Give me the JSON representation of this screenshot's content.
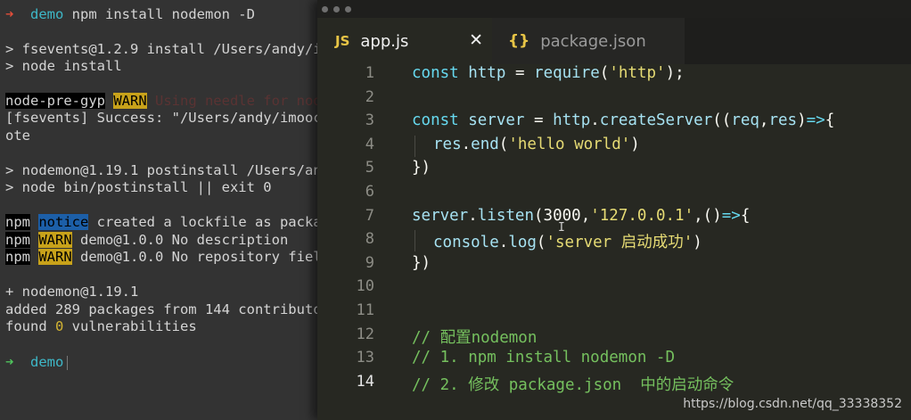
{
  "terminal": {
    "lines": [
      {
        "prompt_arrow": "➜",
        "dir": "demo",
        "cmd": " npm install nodemon -D"
      },
      {
        "text": "> fsevents@1.2.9 install /Users/andy/i"
      },
      {
        "text": "> node install"
      },
      {
        "tag": "node-pre-gyp",
        "warn": "WARN",
        "rest": " Using needle for nod"
      },
      {
        "text": "[fsevents] Success: \"/Users/andy/imooc"
      },
      {
        "text": "ote"
      },
      {
        "text": "> nodemon@1.19.1 postinstall /Users/an"
      },
      {
        "text": "> node bin/postinstall || exit 0"
      },
      {
        "tag": "npm",
        "notice": "notice",
        "rest": " created a lockfile as packa"
      },
      {
        "tag": "npm",
        "warn": "WARN",
        "rest": " demo@1.0.0 No description"
      },
      {
        "tag": "npm",
        "warn": "WARN",
        "rest": " demo@1.0.0 No repository fiel"
      },
      {
        "text": "+ nodemon@1.19.1"
      },
      {
        "text": "added 289 packages from 144 contributo"
      },
      {
        "pre": "found ",
        "zero": "0",
        "post": " vulnerabilities"
      },
      {
        "prompt_arrow": "➜",
        "dir": "demo"
      }
    ]
  },
  "editor": {
    "tabs": [
      {
        "icon": "JS",
        "label": "app.js",
        "close": "✕"
      },
      {
        "icon": "{}",
        "label": "package.json"
      }
    ],
    "line_numbers": [
      "1",
      "2",
      "3",
      "4",
      "5",
      "6",
      "7",
      "8",
      "9",
      "10",
      "11",
      "12",
      "13",
      "14"
    ],
    "current_line": "14",
    "code": {
      "l1": [
        "const",
        "http",
        "=",
        "require",
        "(",
        "'http'",
        ");"
      ],
      "l3": [
        "const",
        "server",
        "=",
        "http",
        ".",
        "createServer",
        "((",
        "req",
        ",",
        "res",
        ")",
        "=>",
        "{"
      ],
      "l4": [
        "res",
        ".",
        "end",
        "(",
        "'hello world'",
        ")"
      ],
      "l5": "})",
      "l7": [
        "server",
        ".",
        "listen",
        "(",
        "3000",
        ",",
        "'127.0.0.1'",
        ",()",
        "=>",
        "{"
      ],
      "l8": [
        "console",
        ".",
        "log",
        "(",
        "'server 启动成功'",
        ")"
      ],
      "l9": "})",
      "l12": "// 配置nodemon",
      "l13": "// 1. npm install nodemon -D",
      "l14": "// 2. 修改 package.json  中的启动命令"
    },
    "cursor_glyph": "I"
  },
  "watermark": "https://blog.csdn.net/qq_33338352"
}
